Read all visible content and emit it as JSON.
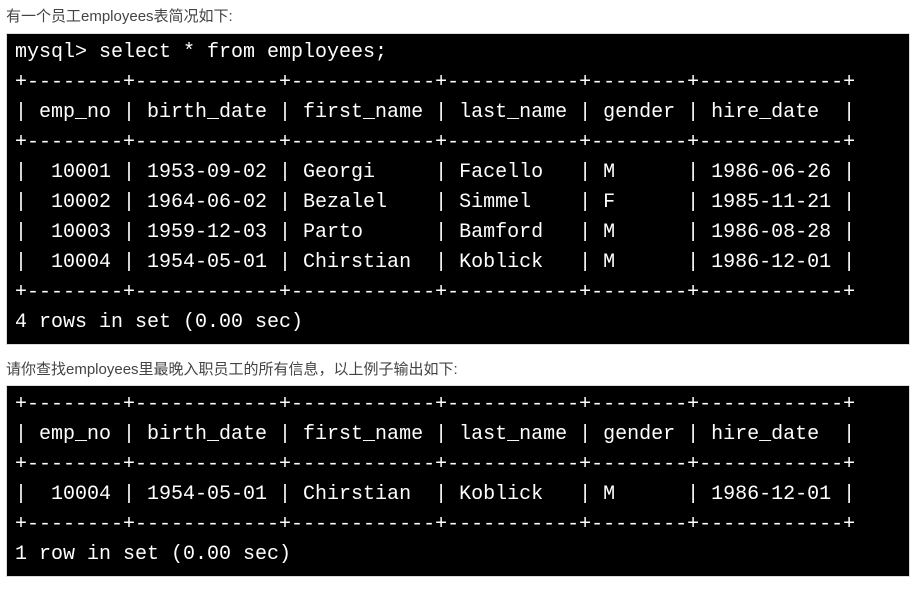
{
  "intro1": "有一个员工employees表简况如下:",
  "intro2": "请你查找employees里最晚入职员工的所有信息，以上例子输出如下:",
  "prompt": "mysql> ",
  "query": "select * from employees;",
  "columns": [
    "emp_no",
    "birth_date",
    "first_name",
    "last_name",
    "gender",
    "hire_date"
  ],
  "rows1": [
    {
      "emp_no": "10001",
      "birth_date": "1953-09-02",
      "first_name": "Georgi",
      "last_name": "Facello",
      "gender": "M",
      "hire_date": "1986-06-26"
    },
    {
      "emp_no": "10002",
      "birth_date": "1964-06-02",
      "first_name": "Bezalel",
      "last_name": "Simmel",
      "gender": "F",
      "hire_date": "1985-11-21"
    },
    {
      "emp_no": "10003",
      "birth_date": "1959-12-03",
      "first_name": "Parto",
      "last_name": "Bamford",
      "gender": "M",
      "hire_date": "1986-08-28"
    },
    {
      "emp_no": "10004",
      "birth_date": "1954-05-01",
      "first_name": "Chirstian",
      "last_name": "Koblick",
      "gender": "M",
      "hire_date": "1986-12-01"
    }
  ],
  "rows2": [
    {
      "emp_no": "10004",
      "birth_date": "1954-05-01",
      "first_name": "Chirstian",
      "last_name": "Koblick",
      "gender": "M",
      "hire_date": "1986-12-01"
    }
  ],
  "footer1": "4 rows in set (0.00 sec)",
  "footer2": "1 row in set (0.00 sec)",
  "chart_data": {
    "type": "table",
    "title": "employees",
    "columns": [
      "emp_no",
      "birth_date",
      "first_name",
      "last_name",
      "gender",
      "hire_date"
    ],
    "data": [
      [
        "10001",
        "1953-09-02",
        "Georgi",
        "Facello",
        "M",
        "1986-06-26"
      ],
      [
        "10002",
        "1964-06-02",
        "Bezalel",
        "Simmel",
        "F",
        "1985-11-21"
      ],
      [
        "10003",
        "1959-12-03",
        "Parto",
        "Bamford",
        "M",
        "1986-08-28"
      ],
      [
        "10004",
        "1954-05-01",
        "Chirstian",
        "Koblick",
        "M",
        "1986-12-01"
      ]
    ],
    "result_latest_hire": [
      [
        "10004",
        "1954-05-01",
        "Chirstian",
        "Koblick",
        "M",
        "1986-12-01"
      ]
    ]
  }
}
